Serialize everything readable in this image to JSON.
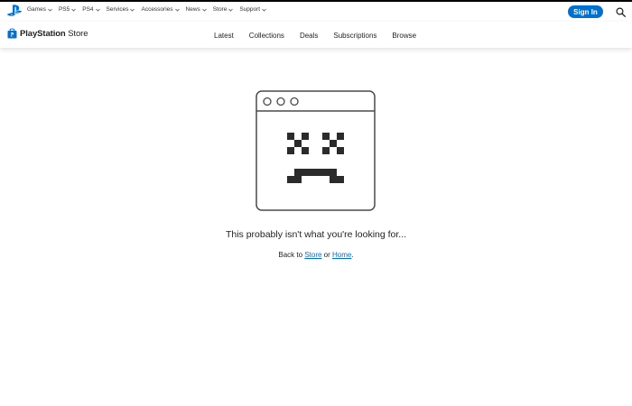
{
  "global_nav": {
    "items": [
      {
        "label": "Games"
      },
      {
        "label": "PS5"
      },
      {
        "label": "PS4"
      },
      {
        "label": "Services"
      },
      {
        "label": "Accessories"
      },
      {
        "label": "News"
      },
      {
        "label": "Store"
      },
      {
        "label": "Support"
      }
    ],
    "sign_in_label": "Sign In",
    "accent_color": "#0070d1"
  },
  "store_nav": {
    "brand_bold": "PlayStation",
    "brand_rest": "Store",
    "tabs": [
      {
        "label": "Latest"
      },
      {
        "label": "Collections"
      },
      {
        "label": "Deals"
      },
      {
        "label": "Subscriptions"
      },
      {
        "label": "Browse"
      }
    ]
  },
  "error": {
    "message": "This probably isn't what you're looking for...",
    "back_prefix": "Back to",
    "store_link": "Store",
    "or_text": "or",
    "home_link": "Home",
    "suffix": "."
  },
  "icons": [
    "playstation-logo-icon",
    "chevron-down-icon",
    "search-icon",
    "store-bag-icon",
    "sad-browser-icon"
  ]
}
